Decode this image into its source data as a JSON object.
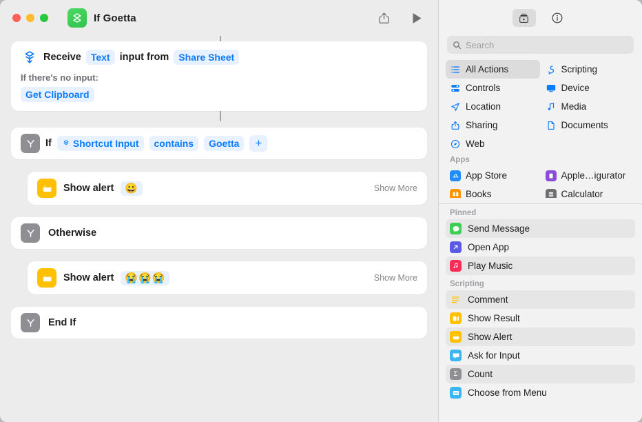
{
  "window": {
    "title": "If Goetta",
    "app_icon": "shortcuts-icon",
    "traffic_lights": [
      "close",
      "minimize",
      "zoom"
    ],
    "toolbar": {
      "share_label": "share-icon",
      "run_label": "play-icon"
    }
  },
  "workflow": {
    "receive": {
      "icon": "shortcut-input-icon",
      "verb": "Receive",
      "type_pill": "Text",
      "middle": "input from",
      "source_pill": "Share Sheet",
      "no_input_label": "If there's no input:",
      "fallback_pill": "Get Clipboard"
    },
    "if": {
      "icon": "branch-icon",
      "keyword": "If",
      "variable_pill": "Shortcut Input",
      "operator_pill": "contains",
      "value_pill": "Goetta",
      "add_pill": "+"
    },
    "alert_true": {
      "icon": "show-alert-icon",
      "label": "Show alert",
      "message": "😀",
      "show_more": "Show More"
    },
    "otherwise": {
      "icon": "branch-icon",
      "label": "Otherwise"
    },
    "alert_false": {
      "icon": "show-alert-icon",
      "label": "Show alert",
      "message": "😭😭😭",
      "show_more": "Show More"
    },
    "end_if": {
      "icon": "branch-icon",
      "label": "End If"
    }
  },
  "library": {
    "tabs": [
      {
        "name": "action-library-icon",
        "selected": true
      },
      {
        "name": "info-icon",
        "selected": false
      }
    ],
    "search": {
      "placeholder": "Search",
      "value": "",
      "icon": "search-icon"
    },
    "categories": [
      {
        "label": "All Actions",
        "icon": "list-icon",
        "selected": true
      },
      {
        "label": "Scripting",
        "icon": "scripting-icon",
        "selected": false
      },
      {
        "label": "Controls",
        "icon": "controls-icon",
        "selected": false
      },
      {
        "label": "Device",
        "icon": "device-icon",
        "selected": false
      },
      {
        "label": "Location",
        "icon": "location-icon",
        "selected": false
      },
      {
        "label": "Media",
        "icon": "media-icon",
        "selected": false
      },
      {
        "label": "Sharing",
        "icon": "sharing-icon",
        "selected": false
      },
      {
        "label": "Documents",
        "icon": "documents-icon",
        "selected": false
      },
      {
        "label": "Web",
        "icon": "web-icon",
        "selected": false
      }
    ],
    "apps_label": "Apps",
    "apps": [
      {
        "label": "App Store",
        "icon": "app-store-icon",
        "color": "#1f8cf9"
      },
      {
        "label": "Apple…igurator",
        "icon": "apple-configurator-icon",
        "color": "#8a4fd6"
      },
      {
        "label": "Books",
        "icon": "books-icon",
        "color": "#ff9500"
      },
      {
        "label": "Calculator",
        "icon": "calculator-icon",
        "color": "#6e6e73"
      }
    ],
    "pinned_label": "Pinned",
    "pinned": [
      {
        "label": "Send Message",
        "icon": "message-icon",
        "color": "#3ecf52"
      },
      {
        "label": "Open App",
        "icon": "open-app-icon",
        "color": "#5b5be6"
      },
      {
        "label": "Play Music",
        "icon": "play-music-icon",
        "color": "#fa2b56"
      }
    ],
    "scripting_label": "Scripting",
    "scripting": [
      {
        "label": "Comment",
        "icon": "comment-icon",
        "color": "#ffc000"
      },
      {
        "label": "Show Result",
        "icon": "show-result-icon",
        "color": "#ffc000"
      },
      {
        "label": "Show Alert",
        "icon": "show-alert-icon",
        "color": "#ffc000"
      },
      {
        "label": "Ask for Input",
        "icon": "ask-input-icon",
        "color": "#3ab6f5"
      },
      {
        "label": "Count",
        "icon": "count-icon",
        "color": "#8e8e93"
      },
      {
        "label": "Choose from Menu",
        "icon": "choose-menu-icon",
        "color": "#3ab6f5"
      }
    ]
  },
  "colors": {
    "accent_blue": "#0a7cff",
    "pill_bg": "#e8f1ff",
    "action_yellow": "#ffc000",
    "action_gray": "#8e8e93",
    "shortcut_green": "#3ec75a"
  }
}
